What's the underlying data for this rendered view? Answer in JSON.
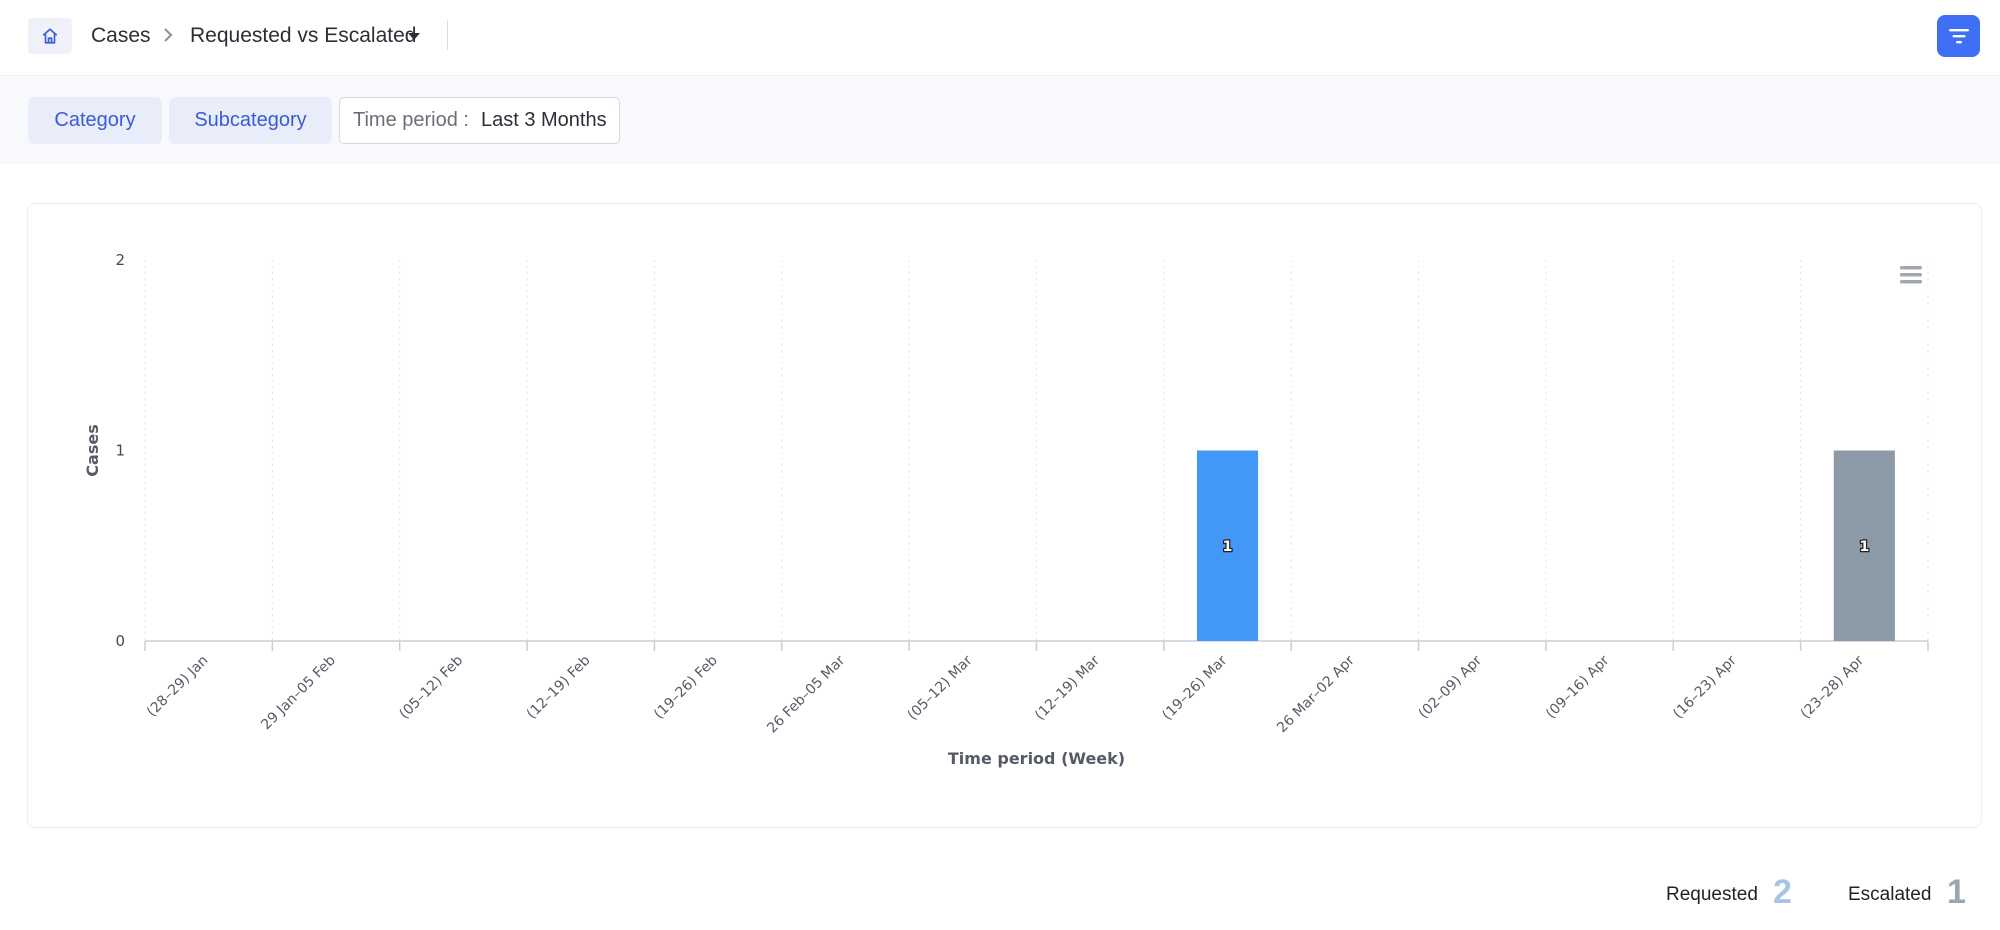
{
  "header": {
    "breadcrumb_root": "Cases",
    "breadcrumb_current": "Requested vs Escalated"
  },
  "filters": {
    "category_label": "Category",
    "subcategory_label": "Subcategory",
    "time_period_label": "Time period :",
    "time_period_value": "Last 3 Months"
  },
  "colors": {
    "accent": "#3f6ff5",
    "requested": "#4397f7",
    "escalated": "#8c9aa8"
  },
  "chart_data": {
    "type": "bar",
    "xlabel": "Time period (Week)",
    "ylabel": "Cases",
    "ylim": [
      0,
      2
    ],
    "yticks": [
      0,
      1,
      2
    ],
    "grid": "vertical dotted",
    "categories": [
      "(28–29) Jan",
      "29 Jan–05 Feb",
      "(05–12) Feb",
      "(12–19) Feb",
      "(19–26) Feb",
      "26 Feb–05 Mar",
      "(05–12) Mar",
      "(12–19) Mar",
      "(19–26) Mar",
      "26 Mar–02 Apr",
      "(02–09) Apr",
      "(09–16) Apr",
      "(16–23) Apr",
      "(23–28) Apr"
    ],
    "series": [
      {
        "name": "Requested",
        "color": "#4397f7",
        "values": [
          0,
          0,
          0,
          0,
          0,
          0,
          0,
          0,
          1,
          0,
          0,
          0,
          0,
          0
        ]
      },
      {
        "name": "Escalated",
        "color": "#8c9aa8",
        "values": [
          0,
          0,
          0,
          0,
          0,
          0,
          0,
          0,
          0,
          0,
          0,
          0,
          0,
          1
        ]
      }
    ]
  },
  "summary": {
    "requested_label": "Requested",
    "requested_value": "2",
    "escalated_label": "Escalated",
    "escalated_value": "1"
  }
}
